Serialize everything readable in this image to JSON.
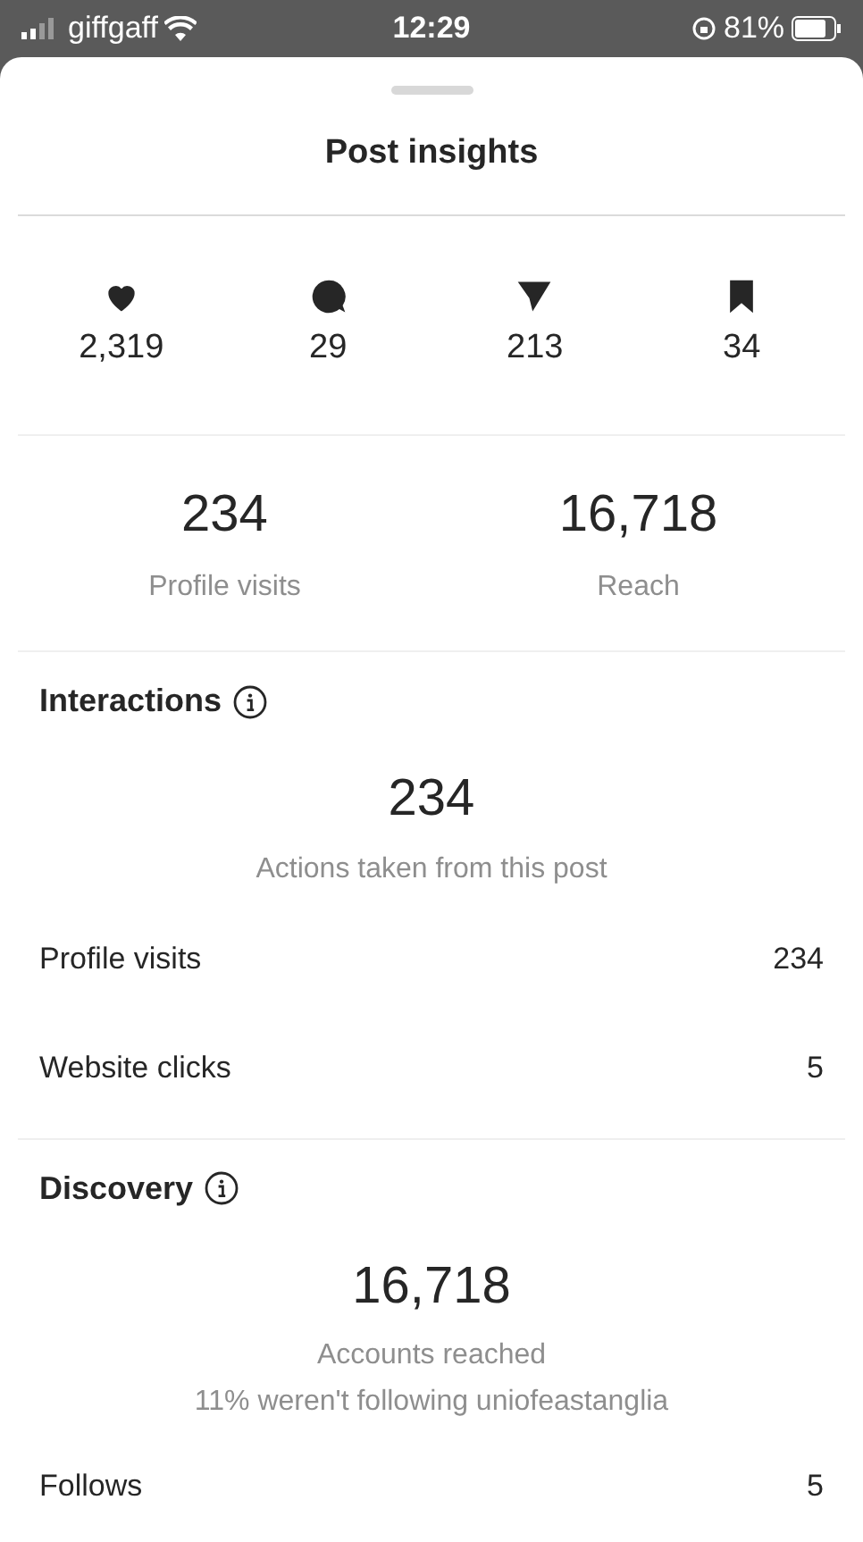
{
  "status_bar": {
    "carrier": "giffgaff",
    "time": "12:29",
    "battery": "81%"
  },
  "title": "Post insights",
  "stats": [
    {
      "kind": "like",
      "value": "2,319"
    },
    {
      "kind": "comment",
      "value": "29"
    },
    {
      "kind": "share",
      "value": "213"
    },
    {
      "kind": "save",
      "value": "34"
    }
  ],
  "summary": [
    {
      "value": "234",
      "label": "Profile visits"
    },
    {
      "value": "16,718",
      "label": "Reach"
    }
  ],
  "sections": [
    {
      "heading": "Interactions",
      "total": "234",
      "caption": [
        "Actions taken from this post"
      ],
      "rows": [
        {
          "label": "Profile visits",
          "value": "234"
        },
        {
          "label": "Website clicks",
          "value": "5"
        }
      ]
    },
    {
      "heading": "Discovery",
      "total": "16,718",
      "caption": [
        "Accounts reached",
        "11% weren't following uniofeastanglia"
      ],
      "rows": [
        {
          "label": "Follows",
          "value": "5"
        }
      ]
    }
  ]
}
